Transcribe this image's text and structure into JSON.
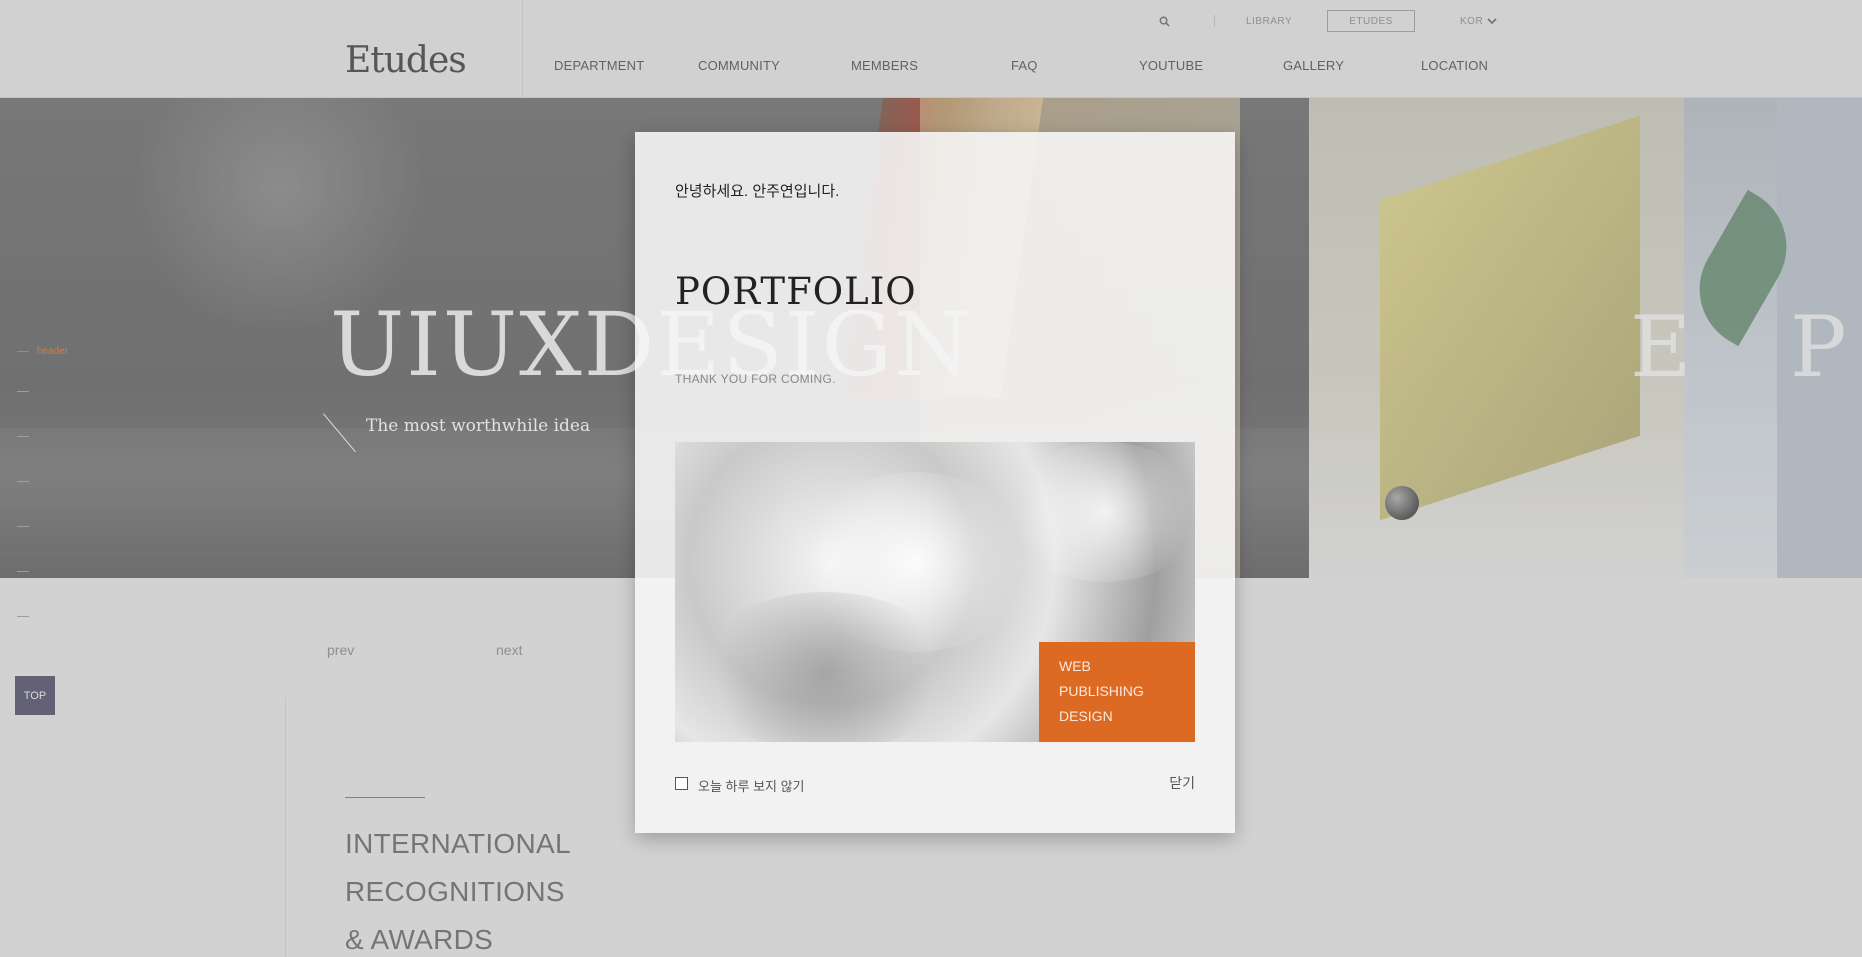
{
  "header": {
    "logo": "Etudes",
    "util": {
      "search_icon": "search-icon",
      "library": "LIBRARY",
      "etudes": "ETUDES",
      "lang": "KOR"
    },
    "nav": [
      "DEPARTMENT",
      "COMMUNITY",
      "MEMBERS",
      "FAQ",
      "YOUTUBE",
      "GALLERY",
      "LOCATION"
    ]
  },
  "hero": {
    "title": "UIUXDESIGN",
    "title_next": "E P I",
    "subtitle": "The most worthwhile idea"
  },
  "quick_nav": {
    "active_label": "header",
    "count": 7
  },
  "slider": {
    "prev": "prev",
    "next": "next"
  },
  "top_button": "TOP",
  "awards": {
    "line1": "INTERNATIONAL",
    "line2": "RECOGNITIONS",
    "line3": "& AWARDS"
  },
  "popup": {
    "greeting": "안녕하세요. 안주연입니다.",
    "title": "PORTFOLIO",
    "subtitle": "THANK YOU FOR COMING.",
    "badge_line1": "WEB",
    "badge_line2": "PUBLISHING",
    "badge_line3": "DESIGN",
    "checkbox_label": "오늘 하루 보지 않기",
    "close": "닫기"
  },
  "colors": {
    "accent": "#dc6a22",
    "top_button": "#3b3a55"
  }
}
